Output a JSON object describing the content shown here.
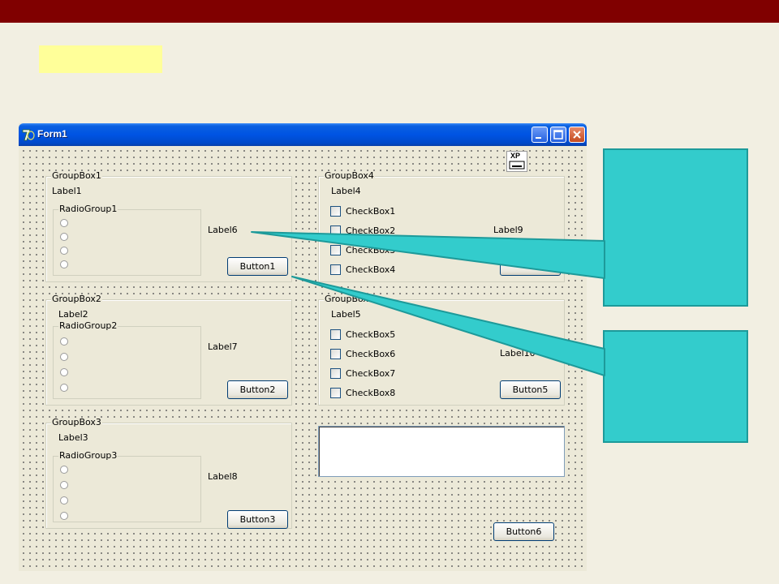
{
  "window": {
    "title": "Form1",
    "xp_icon_text": "XP"
  },
  "group_boxes": [
    {
      "caption": "GroupBox1",
      "label": "Label1",
      "radio_caption": "RadioGroup1",
      "side_label": "Label6",
      "button": "Button1"
    },
    {
      "caption": "GroupBox2",
      "label": "Label2",
      "radio_caption": "RadioGroup2",
      "side_label": "Label7",
      "button": "Button2"
    },
    {
      "caption": "GroupBox3",
      "label": "Label3",
      "radio_caption": "RadioGroup3",
      "side_label": "Label8",
      "button": "Button3"
    },
    {
      "caption": "GroupBox4",
      "label": "Label4",
      "side_label": "Label9",
      "checkboxes": [
        "CheckBox1",
        "CheckBox2",
        "CheckBox3",
        "CheckBox4"
      ]
    },
    {
      "caption": "GroupBox5",
      "label": "Label5",
      "side_label": "Label10",
      "button": "Button5",
      "checkboxes": [
        "CheckBox5",
        "CheckBox6",
        "CheckBox7",
        "CheckBox8"
      ]
    }
  ],
  "button6": "Button6",
  "colors": {
    "top_bar": "#800000",
    "highlight": "#ffff99",
    "callout": "#33cccc",
    "background": "#f2efe2"
  }
}
